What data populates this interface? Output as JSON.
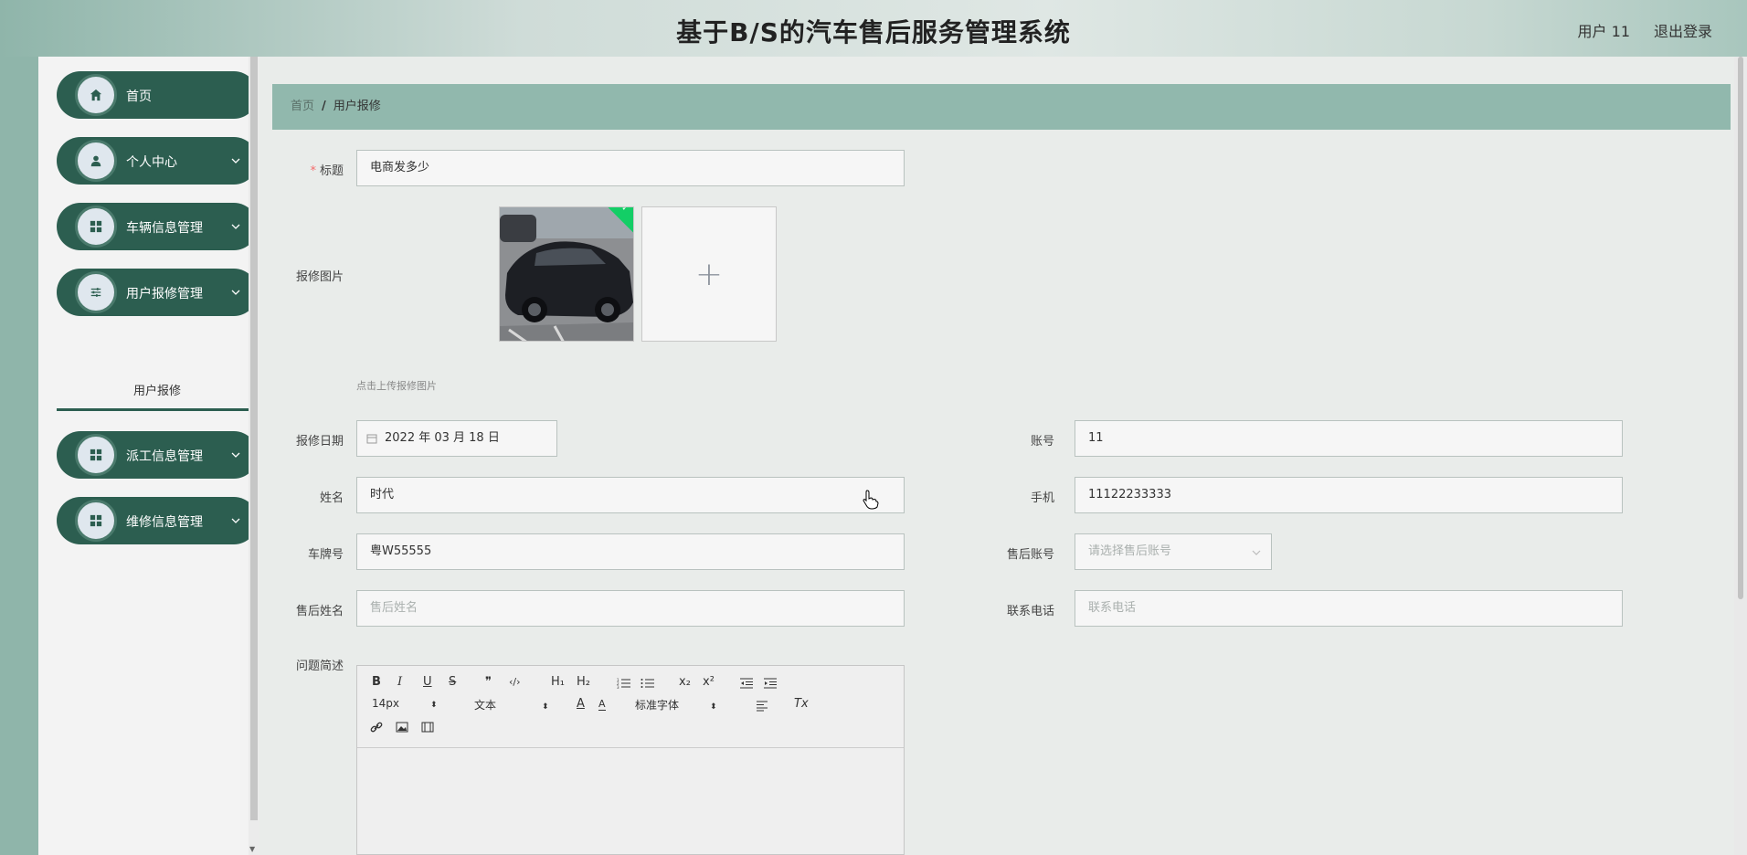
{
  "header": {
    "title": "基于B/S的汽车售后服务管理系统",
    "user": "用户 11",
    "logout": "退出登录"
  },
  "sidebar": {
    "items": [
      {
        "label": "首页"
      },
      {
        "label": "个人中心"
      },
      {
        "label": "车辆信息管理"
      },
      {
        "label": "用户报修管理"
      },
      {
        "label": "派工信息管理"
      },
      {
        "label": "维修信息管理"
      }
    ],
    "sub_active": "用户报修"
  },
  "breadcrumb": {
    "home": "首页",
    "sep": "/",
    "current": "用户报修"
  },
  "form": {
    "title_label": "标题",
    "title_value": "电商发多少",
    "image_label": "报修图片",
    "image_tip": "点击上传报修图片",
    "date_label": "报修日期",
    "date_value": "2022 年 03 月 18 日",
    "account_label": "账号",
    "account_value": "11",
    "name_label": "姓名",
    "name_value": "时代",
    "phone_label": "手机",
    "phone_value": "11122233333",
    "plate_label": "车牌号",
    "plate_value": "粤W55555",
    "service_account_label": "售后账号",
    "service_account_placeholder": "请选择售后账号",
    "service_name_label": "售后姓名",
    "service_name_placeholder": "售后姓名",
    "contact_label": "联系电话",
    "contact_placeholder": "联系电话",
    "desc_label": "问题简述"
  },
  "editor": {
    "font_size": "14px",
    "text_type": "文本",
    "font_family": "标准字体",
    "buttons": {
      "bold": "B",
      "italic": "I",
      "underline": "U",
      "strike": "S",
      "quote": "❞",
      "code": "‹/›",
      "h1": "H₁",
      "h2": "H₂",
      "sub": "x₂",
      "sup": "x²",
      "color": "A",
      "clear": "Tx"
    }
  }
}
